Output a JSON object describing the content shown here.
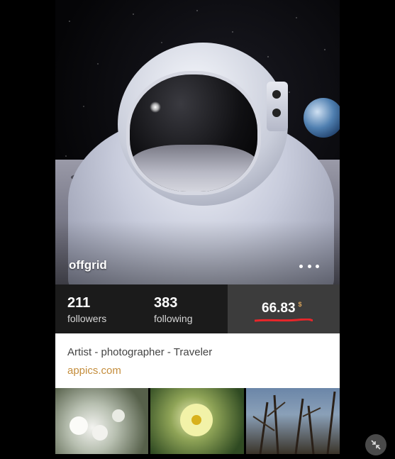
{
  "profile": {
    "username": "offgrid",
    "stats": {
      "followers_count": "211",
      "followers_label": "followers",
      "following_count": "383",
      "following_label": "following",
      "balance_value": "66.83",
      "balance_currency": "$"
    },
    "bio": "Artist - photographer - Traveler",
    "link": "appics.com"
  },
  "icons": {
    "more": "more-horizontal-icon",
    "collapse": "collapse-arrows-icon"
  },
  "colors": {
    "accent": "#c48d3c",
    "underline": "#e8262a",
    "stats_dark": "#1b1b1b",
    "stats_balance_bg": "#3c3c3c"
  }
}
